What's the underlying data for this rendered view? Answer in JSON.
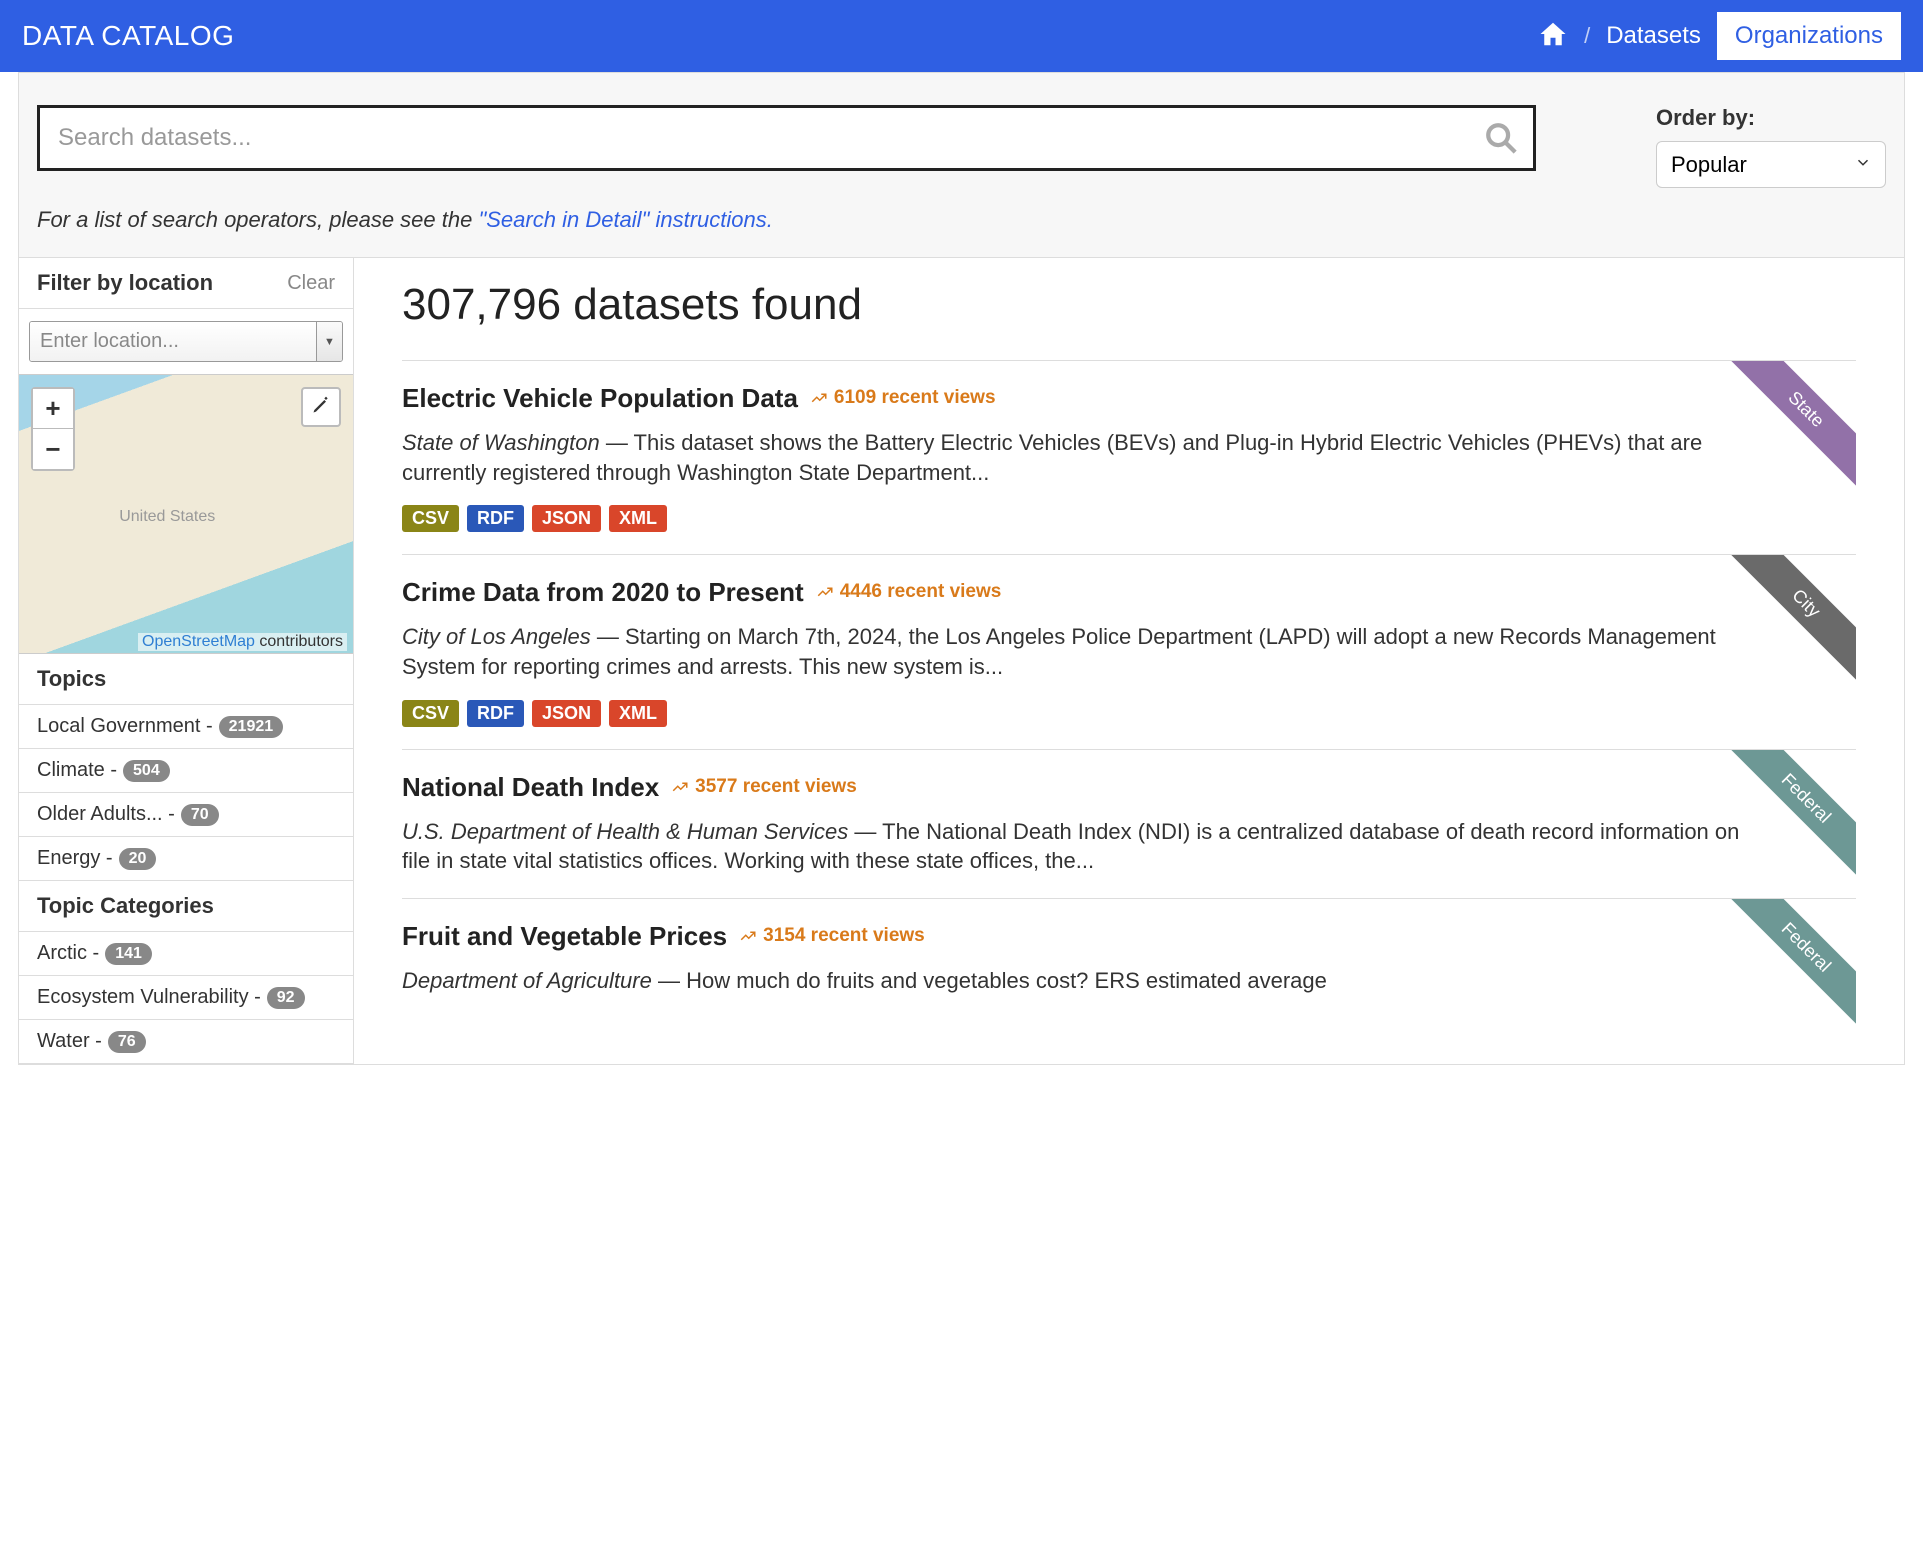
{
  "header": {
    "title": "DATA CATALOG",
    "nav_datasets": "Datasets",
    "nav_organizations": "Organizations",
    "separator": "/"
  },
  "search": {
    "placeholder": "Search datasets...",
    "hint_prefix": "For a list of search operators, please see the ",
    "hint_link": "\"Search in Detail\" instructions.",
    "order_label": "Order by:",
    "order_value": "Popular"
  },
  "location_filter": {
    "title": "Filter by location",
    "clear": "Clear",
    "placeholder": "Enter location...",
    "map_label": "United States",
    "osm_link": "OpenStreetMap",
    "osm_suffix": " contributors"
  },
  "topics": {
    "title": "Topics",
    "items": [
      {
        "label": "Local Government",
        "count": "21921"
      },
      {
        "label": "Climate",
        "count": "504"
      },
      {
        "label": "Older Adults...",
        "count": "70"
      },
      {
        "label": "Energy",
        "count": "20"
      }
    ]
  },
  "topic_categories": {
    "title": "Topic Categories",
    "items": [
      {
        "label": "Arctic",
        "count": "141"
      },
      {
        "label": "Ecosystem Vulnerability",
        "count": "92"
      },
      {
        "label": "Water",
        "count": "76"
      }
    ]
  },
  "results": {
    "count_text": "307,796 datasets found",
    "datasets": [
      {
        "title": "Electric Vehicle Population Data",
        "views": "6109 recent views",
        "org": "State of Washington",
        "desc": " — This dataset shows the Battery Electric Vehicles (BEVs) and Plug-in Hybrid Electric Vehicles (PHEVs) that are currently registered through Washington State Department...",
        "formats": [
          "CSV",
          "RDF",
          "JSON",
          "XML"
        ],
        "ribbon": "State",
        "ribbon_class": "ribbon-state"
      },
      {
        "title": "Crime Data from 2020 to Present",
        "views": "4446 recent views",
        "org": "City of Los Angeles",
        "desc": " — Starting on March 7th, 2024, the Los Angeles Police Department (LAPD) will adopt a new Records Management System for reporting crimes and arrests. This new system is...",
        "formats": [
          "CSV",
          "RDF",
          "JSON",
          "XML"
        ],
        "ribbon": "City",
        "ribbon_class": "ribbon-city"
      },
      {
        "title": "National Death Index",
        "views": "3577 recent views",
        "org": "U.S. Department of Health & Human Services",
        "desc": " — The National Death Index (NDI) is a centralized database of death record information on file in state vital statistics offices. Working with these state offices, the...",
        "formats": [],
        "ribbon": "Federal",
        "ribbon_class": "ribbon-federal"
      },
      {
        "title": "Fruit and Vegetable Prices",
        "views": "3154 recent views",
        "org": "Department of Agriculture",
        "desc": " — How much do fruits and vegetables cost? ERS estimated average",
        "formats": [],
        "ribbon": "Federal",
        "ribbon_class": "ribbon-federal"
      }
    ]
  }
}
